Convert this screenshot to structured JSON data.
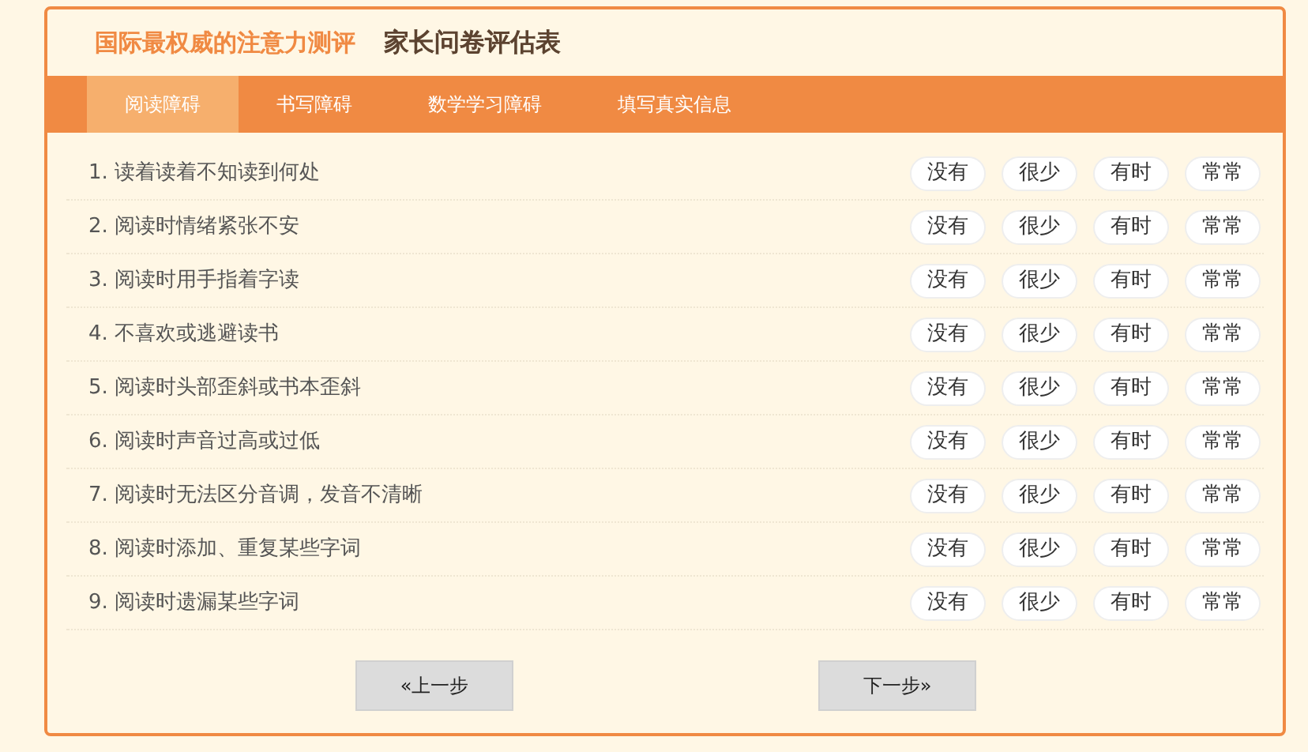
{
  "header": {
    "brand": "国际最权威的注意力测评",
    "title": "家长问卷评估表"
  },
  "tabs": [
    {
      "label": "阅读障碍",
      "selected": true
    },
    {
      "label": "书写障碍",
      "selected": false
    },
    {
      "label": "数学学习障碍",
      "selected": false
    },
    {
      "label": "填写真实信息",
      "selected": false
    }
  ],
  "questions": [
    {
      "text": "1. 读着读着不知读到何处",
      "options": [
        {
          "label": "没有",
          "selected": false
        },
        {
          "label": "很少",
          "selected": false
        },
        {
          "label": "有时",
          "selected": false
        },
        {
          "label": "常常",
          "selected": false
        }
      ]
    },
    {
      "text": "2. 阅读时情绪紧张不安",
      "options": [
        {
          "label": "没有",
          "selected": false
        },
        {
          "label": "很少",
          "selected": false
        },
        {
          "label": "有时",
          "selected": false
        },
        {
          "label": "常常",
          "selected": false
        }
      ]
    },
    {
      "text": "3. 阅读时用手指着字读",
      "options": [
        {
          "label": "没有",
          "selected": false
        },
        {
          "label": "很少",
          "selected": false
        },
        {
          "label": "有时",
          "selected": false
        },
        {
          "label": "常常",
          "selected": false
        }
      ]
    },
    {
      "text": "4. 不喜欢或逃避读书",
      "options": [
        {
          "label": "没有",
          "selected": false
        },
        {
          "label": "很少",
          "selected": false
        },
        {
          "label": "有时",
          "selected": false
        },
        {
          "label": "常常",
          "selected": false
        }
      ]
    },
    {
      "text": "5. 阅读时头部歪斜或书本歪斜",
      "options": [
        {
          "label": "没有",
          "selected": false
        },
        {
          "label": "很少",
          "selected": false
        },
        {
          "label": "有时",
          "selected": false
        },
        {
          "label": "常常",
          "selected": false
        }
      ]
    },
    {
      "text": "6. 阅读时声音过高或过低",
      "options": [
        {
          "label": "没有",
          "selected": false
        },
        {
          "label": "很少",
          "selected": false
        },
        {
          "label": "有时",
          "selected": false
        },
        {
          "label": "常常",
          "selected": false
        }
      ]
    },
    {
      "text": "7. 阅读时无法区分音调，发音不清晰",
      "options": [
        {
          "label": "没有",
          "selected": false
        },
        {
          "label": "很少",
          "selected": false
        },
        {
          "label": "有时",
          "selected": false
        },
        {
          "label": "常常",
          "selected": false
        }
      ]
    },
    {
      "text": "8. 阅读时添加、重复某些字词",
      "options": [
        {
          "label": "没有",
          "selected": false
        },
        {
          "label": "很少",
          "selected": false
        },
        {
          "label": "有时",
          "selected": false
        },
        {
          "label": "常常",
          "selected": false
        }
      ]
    },
    {
      "text": "9. 阅读时遗漏某些字词",
      "options": [
        {
          "label": "没有",
          "selected": false
        },
        {
          "label": "很少",
          "selected": false
        },
        {
          "label": "有时",
          "selected": false
        },
        {
          "label": "常常",
          "selected": false
        }
      ]
    }
  ],
  "buttons": {
    "prev": "«上一步",
    "next": "下一步»"
  }
}
